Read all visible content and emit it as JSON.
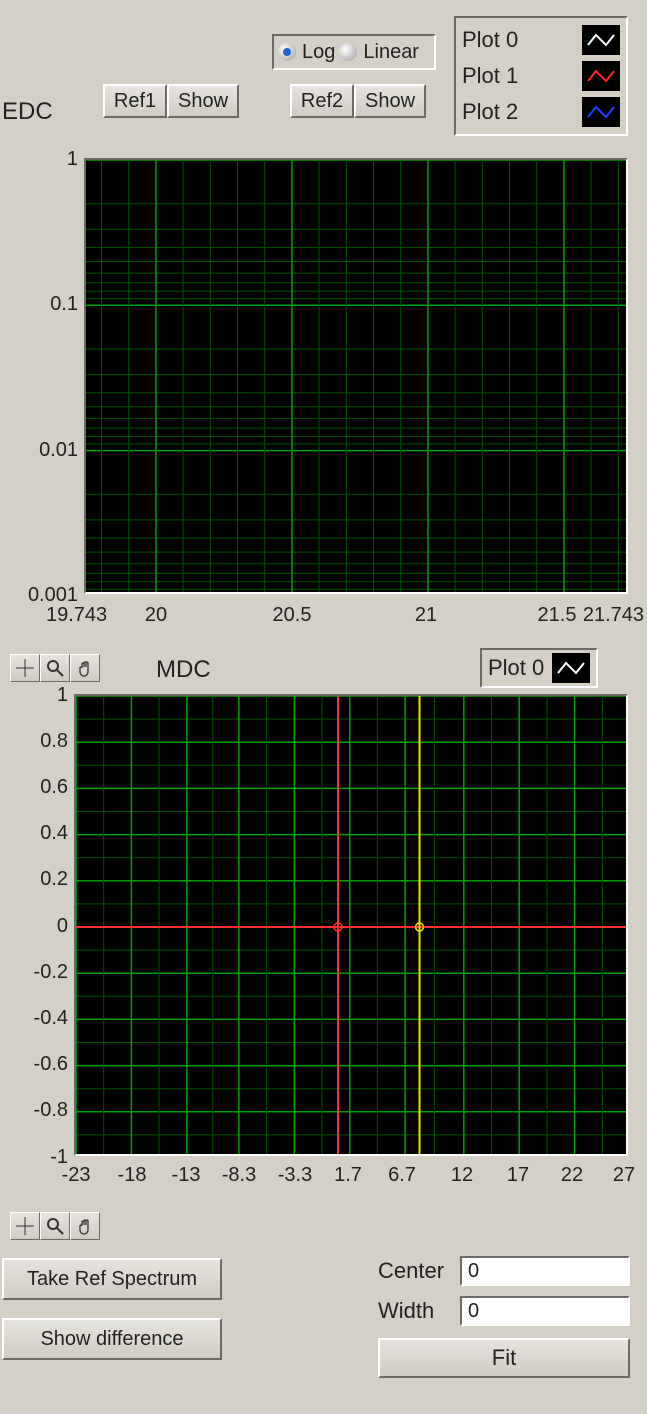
{
  "top": {
    "radio": {
      "option1": "Log",
      "option2": "Linear",
      "selected": "Log"
    },
    "buttons": {
      "ref1": "Ref1",
      "show1": "Show",
      "ref2": "Ref2",
      "show2": "Show"
    }
  },
  "edc": {
    "label": "EDC",
    "legend": [
      {
        "label": "Plot 0",
        "color": "#ffffff"
      },
      {
        "label": "Plot 1",
        "color": "#ff2020"
      },
      {
        "label": "Plot 2",
        "color": "#2040ff"
      }
    ],
    "y_ticks": [
      "1",
      "0.1",
      "0.01",
      "0.001"
    ],
    "x_ticks": [
      "19.743",
      "20",
      "20.5",
      "21",
      "21.5",
      "21.743"
    ]
  },
  "mdc": {
    "label": "MDC",
    "legend": [
      {
        "label": "Plot 0",
        "color": "#ffffff"
      }
    ],
    "y_ticks": [
      "1",
      "0.8",
      "0.6",
      "0.4",
      "0.2",
      "0",
      "-0.2",
      "-0.4",
      "-0.6",
      "-0.8",
      "-1"
    ],
    "x_ticks": [
      "-23",
      "-18",
      "-13",
      "-8.3",
      "-3.3",
      "1.7",
      "6.7",
      "12",
      "17",
      "22",
      "27"
    ],
    "cursors": [
      {
        "color": "red",
        "x_frac": 0.473,
        "y_frac": 0.5
      },
      {
        "color": "yellow",
        "x_frac": 0.62,
        "y_frac": 0.5
      }
    ]
  },
  "bottom": {
    "take_ref": "Take Ref Spectrum",
    "show_diff": "Show difference",
    "center_label": "Center",
    "center_value": "0",
    "width_label": "Width",
    "width_value": "0",
    "fit": "Fit"
  },
  "chart_data": [
    {
      "name": "EDC",
      "type": "line",
      "yscale": "log",
      "xlim": [
        19.743,
        21.743
      ],
      "ylim": [
        0.001,
        1
      ],
      "x_ticks_major": [
        20,
        20.5,
        21,
        21.5
      ],
      "y_ticks_major": [
        0.001,
        0.01,
        0.1,
        1
      ],
      "series": [
        {
          "name": "Plot 0",
          "color": "#ffffff",
          "values": []
        },
        {
          "name": "Plot 1",
          "color": "#ff2020",
          "values": []
        },
        {
          "name": "Plot 2",
          "color": "#2040ff",
          "values": []
        }
      ],
      "title": "",
      "xlabel": "",
      "ylabel": "",
      "grid": true
    },
    {
      "name": "MDC",
      "type": "line",
      "yscale": "linear",
      "xlim": [
        -23,
        27
      ],
      "ylim": [
        -1,
        1
      ],
      "x_ticks_major": [
        -23,
        -18,
        -13,
        -8.3,
        -3.3,
        1.7,
        6.7,
        12,
        17,
        22,
        27
      ],
      "y_ticks_major": [
        -1,
        -0.8,
        -0.6,
        -0.4,
        -0.2,
        0,
        0.2,
        0.4,
        0.6,
        0.8,
        1
      ],
      "series": [
        {
          "name": "Plot 0",
          "color": "#ffffff",
          "values": []
        }
      ],
      "cursors": [
        {
          "color": "red",
          "x": 0.65,
          "y": 0
        },
        {
          "color": "yellow",
          "x": 8.0,
          "y": 0
        }
      ],
      "title": "",
      "xlabel": "",
      "ylabel": "",
      "grid": true
    }
  ]
}
